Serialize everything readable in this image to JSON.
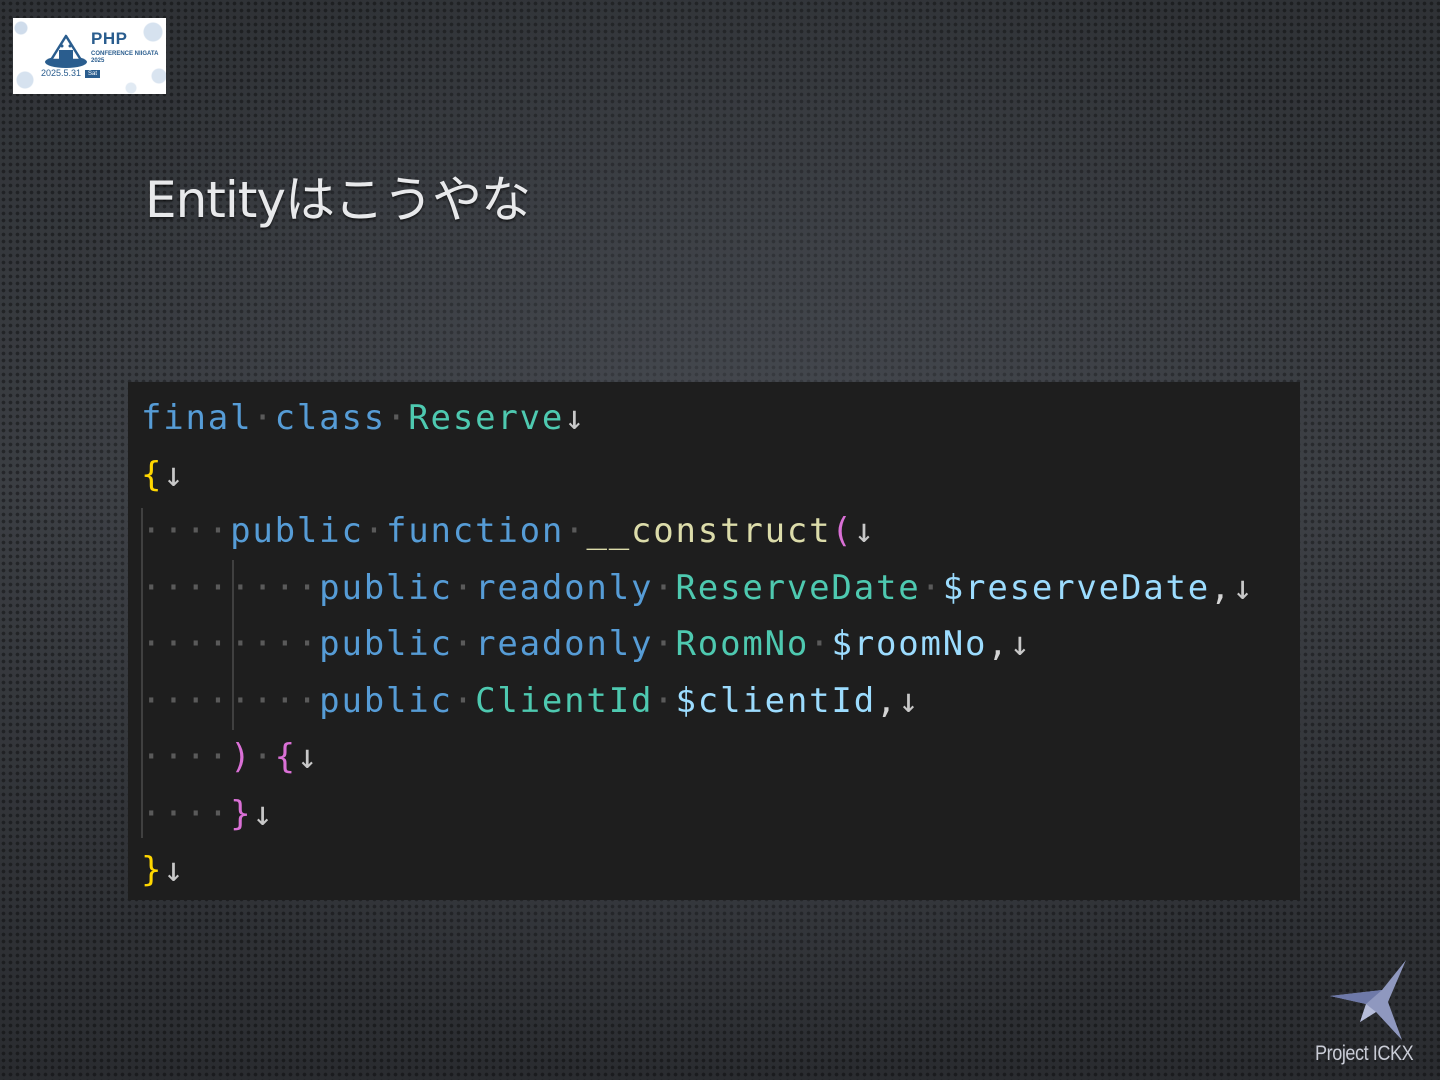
{
  "conference_logo": {
    "brand": "PHP",
    "subtitle": "CONFERENCE NIIGATA 2025",
    "date": "2025.5.31",
    "day": "Sat"
  },
  "slide": {
    "title": "Entityはこうやな"
  },
  "code": {
    "eol_marker": "↓",
    "space_marker": "·",
    "lines": [
      {
        "indent": 0,
        "tokens": [
          {
            "t": "final",
            "c": "kw"
          },
          {
            "t": "·",
            "c": "ws"
          },
          {
            "t": "class",
            "c": "kw"
          },
          {
            "t": "·",
            "c": "ws"
          },
          {
            "t": "Reserve",
            "c": "type"
          }
        ]
      },
      {
        "indent": 0,
        "tokens": [
          {
            "t": "{",
            "c": "brace1"
          }
        ]
      },
      {
        "indent": 1,
        "tokens": [
          {
            "t": "public",
            "c": "kw"
          },
          {
            "t": "·",
            "c": "ws"
          },
          {
            "t": "function",
            "c": "kw"
          },
          {
            "t": "·",
            "c": "ws"
          },
          {
            "t": "__construct",
            "c": "fn"
          },
          {
            "t": "(",
            "c": "brace2"
          }
        ]
      },
      {
        "indent": 2,
        "tokens": [
          {
            "t": "public",
            "c": "kw"
          },
          {
            "t": "·",
            "c": "ws"
          },
          {
            "t": "readonly",
            "c": "kw"
          },
          {
            "t": "·",
            "c": "ws"
          },
          {
            "t": "ReserveDate",
            "c": "type"
          },
          {
            "t": "·",
            "c": "ws"
          },
          {
            "t": "$reserveDate",
            "c": "var"
          },
          {
            "t": ",",
            "c": "punct"
          }
        ]
      },
      {
        "indent": 2,
        "tokens": [
          {
            "t": "public",
            "c": "kw"
          },
          {
            "t": "·",
            "c": "ws"
          },
          {
            "t": "readonly",
            "c": "kw"
          },
          {
            "t": "·",
            "c": "ws"
          },
          {
            "t": "RoomNo",
            "c": "type"
          },
          {
            "t": "·",
            "c": "ws"
          },
          {
            "t": "$roomNo",
            "c": "var"
          },
          {
            "t": ",",
            "c": "punct"
          }
        ]
      },
      {
        "indent": 2,
        "tokens": [
          {
            "t": "public",
            "c": "kw"
          },
          {
            "t": "·",
            "c": "ws"
          },
          {
            "t": "ClientId",
            "c": "type"
          },
          {
            "t": "·",
            "c": "ws"
          },
          {
            "t": "$clientId",
            "c": "var"
          },
          {
            "t": ",",
            "c": "punct"
          }
        ]
      },
      {
        "indent": 1,
        "tokens": [
          {
            "t": ")",
            "c": "brace2"
          },
          {
            "t": "·",
            "c": "ws"
          },
          {
            "t": "{",
            "c": "brace2"
          }
        ]
      },
      {
        "indent": 1,
        "tokens": [
          {
            "t": "}",
            "c": "brace2"
          }
        ]
      },
      {
        "indent": 0,
        "tokens": [
          {
            "t": "}",
            "c": "brace1"
          }
        ]
      }
    ]
  },
  "project_logo": {
    "label": "Project ICKX"
  },
  "colors": {
    "code_background": "#1e1e1e",
    "keyword": "#569cd6",
    "type": "#4ec9b0",
    "function": "#dcdcaa",
    "variable": "#9cdcfe",
    "bracket_level1": "#ffd700",
    "bracket_level2": "#da70d6"
  }
}
